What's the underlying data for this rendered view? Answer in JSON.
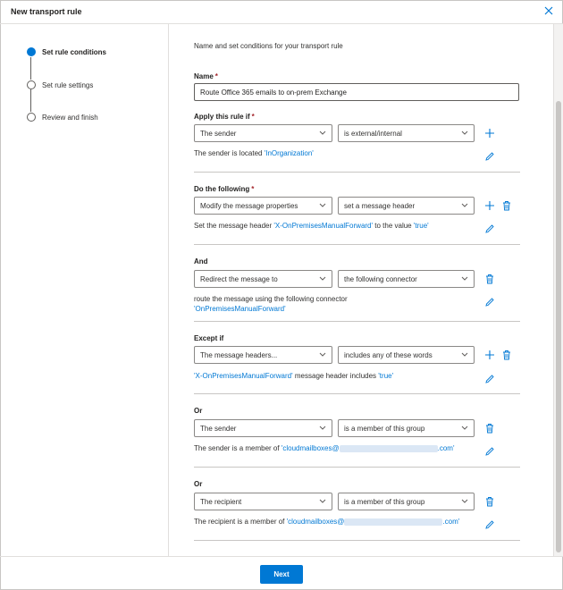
{
  "window": {
    "title": "New transport rule"
  },
  "steps": [
    {
      "label": "Set rule conditions",
      "active": true
    },
    {
      "label": "Set rule settings",
      "active": false
    },
    {
      "label": "Review and finish",
      "active": false
    }
  ],
  "intro": "Name and set conditions for your transport rule",
  "name_field": {
    "label": "Name",
    "required_mark": "*",
    "value": "Route Office 365 emails to on-prem Exchange"
  },
  "apply": {
    "label": "Apply this rule if",
    "required_mark": "*",
    "condition": "The sender",
    "predicate": "is external/internal",
    "desc_prefix": "The sender is located ",
    "desc_value": "'InOrganization'"
  },
  "do": {
    "label": "Do the following",
    "required_mark": "*",
    "action": "Modify the message properties",
    "detail": "set a message header",
    "desc_a": "Set the message header ",
    "desc_header": "'X-OnPremisesManualForward'",
    "desc_b": " to the value ",
    "desc_value": "'true'"
  },
  "and": {
    "label": "And",
    "action": "Redirect the message to",
    "detail": "the following connector",
    "desc_line1": "route the message using the following connector",
    "desc_value": "'OnPremisesManualForward'"
  },
  "except": {
    "label": "Except if",
    "condition": "The message headers...",
    "predicate": "includes any of these words",
    "desc_header": "'X-OnPremisesManualForward'",
    "desc_mid": " message header includes ",
    "desc_value": "'true'"
  },
  "or1": {
    "label": "Or",
    "condition": "The sender",
    "predicate": "is a member of this group",
    "desc_prefix": "The sender is a member of ",
    "desc_link_start": "'cloudmailboxes@",
    "desc_link_end": ".com'"
  },
  "or2": {
    "label": "Or",
    "condition": "The recipient",
    "predicate": "is a member of this group",
    "desc_prefix": "The recipient is a member of ",
    "desc_link_start": "'cloudmailboxes@",
    "desc_link_end": ".com'"
  },
  "footer": {
    "next_label": "Next"
  },
  "colors": {
    "accent": "#0078d4",
    "required": "#a4262c",
    "border": "#8a8886"
  },
  "icons": [
    "close-icon",
    "add-icon",
    "delete-icon",
    "edit-icon",
    "chevron-down-icon"
  ]
}
